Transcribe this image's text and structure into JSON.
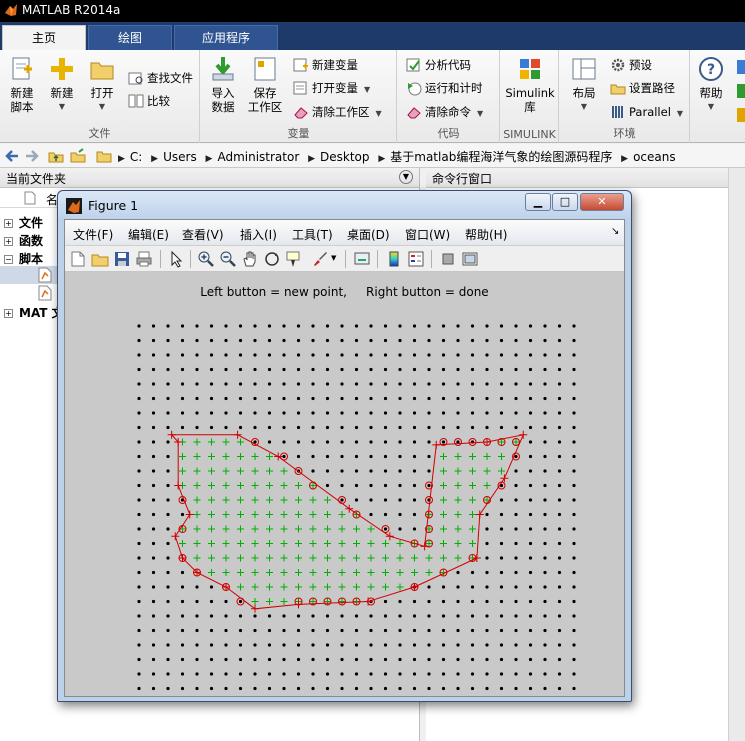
{
  "app": {
    "title": "MATLAB R2014a"
  },
  "tabs": [
    {
      "label": "主页",
      "active": true
    },
    {
      "label": "绘图",
      "active": false
    },
    {
      "label": "应用程序",
      "active": false
    }
  ],
  "ribbon": {
    "file": {
      "label": "文件",
      "new_script": "新建\n脚本",
      "new": "新建",
      "open": "打开",
      "find_files": "查找文件",
      "compare": "比较"
    },
    "variable": {
      "label": "变量",
      "import": "导入\n数据",
      "save_ws": "保存\n工作区",
      "new_var": "新建变量",
      "open_var": "打开变量",
      "clear_ws": "清除工作区"
    },
    "code": {
      "label": "代码",
      "analyze": "分析代码",
      "run_time": "运行和计时",
      "clear_cmd": "清除命令"
    },
    "simulink": {
      "label": "SIMULINK",
      "button": "Simulink\n库"
    },
    "env": {
      "label": "环境",
      "layout": "布局",
      "prefs": "预设",
      "set_path": "设置路径",
      "parallel": "Parallel",
      "help": "帮助"
    }
  },
  "address": {
    "crumbs": [
      "C:",
      "Users",
      "Administrator",
      "Desktop",
      "基于matlab编程海洋气象的绘图源码程序",
      "oceans"
    ]
  },
  "left_panel": {
    "title": "当前文件夹",
    "col_name": "名",
    "tree": [
      "文件",
      "函数",
      "脚本",
      "MAT 文"
    ]
  },
  "right_panel": {
    "title": "命令行窗口"
  },
  "figure": {
    "title": "Figure 1",
    "menu": [
      "文件(F)",
      "编辑(E)",
      "查看(V)",
      "插入(I)",
      "工具(T)",
      "桌面(D)",
      "窗口(W)",
      "帮助(H)"
    ],
    "instruction": "Left button = new point,     Right button = done"
  },
  "colors": {
    "grid_dot": "#000000",
    "inside_point": "#00b000",
    "polygon": "#d00000",
    "tab_bar": "#1e3a6b"
  }
}
